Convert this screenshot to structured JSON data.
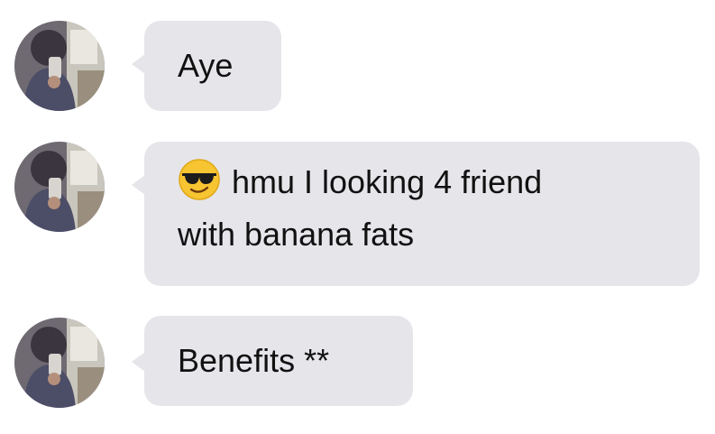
{
  "conversation": {
    "messages": [
      {
        "lines": [
          "Aye"
        ],
        "emoji": ""
      },
      {
        "lines": [
          "hmu I looking 4 friend",
          "with banana fats"
        ],
        "emoji": "sunglasses-face-icon"
      },
      {
        "lines": [
          "Benefits **"
        ],
        "emoji": ""
      }
    ]
  },
  "colors": {
    "bubble_background": "#e6e5ea",
    "text": "#111111",
    "page_background": "#ffffff",
    "emoji_face": "#f7c531"
  }
}
